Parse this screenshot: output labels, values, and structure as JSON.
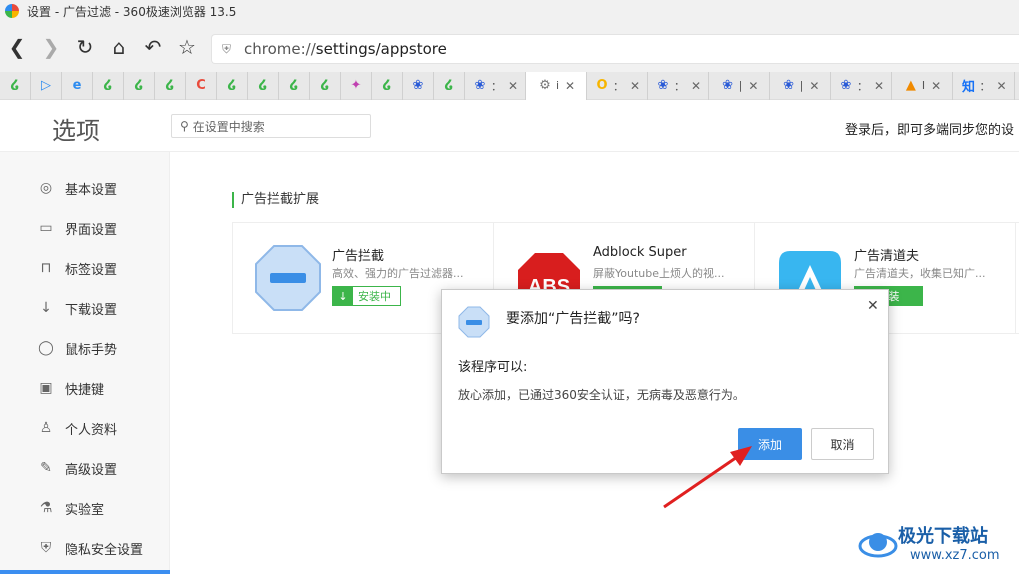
{
  "window": {
    "title": "设置 - 广告过滤 - 360极速浏览器 13.5"
  },
  "address": {
    "url_prefix": "chrome://",
    "url_rest": "settings/appstore"
  },
  "tabs": [
    {
      "icon": "360-icon",
      "color": "#3cb54a",
      "glyph": "໒",
      "close": false
    },
    {
      "icon": "play-icon",
      "color": "#2d8cf0",
      "glyph": "▷",
      "close": false
    },
    {
      "icon": "ie-icon",
      "color": "#2d8cf0",
      "glyph": "e",
      "close": false
    },
    {
      "icon": "360-icon",
      "color": "#3cb54a",
      "glyph": "໒",
      "close": false
    },
    {
      "icon": "360-icon",
      "color": "#3cb54a",
      "glyph": "໒",
      "close": false
    },
    {
      "icon": "360-icon",
      "color": "#3cb54a",
      "glyph": "໒",
      "close": false
    },
    {
      "icon": "c-icon",
      "color": "#e94b3c",
      "glyph": "C",
      "close": false
    },
    {
      "icon": "360-icon",
      "color": "#3cb54a",
      "glyph": "໒",
      "close": false
    },
    {
      "icon": "360-icon",
      "color": "#3cb54a",
      "glyph": "໒",
      "close": false
    },
    {
      "icon": "360-icon",
      "color": "#3cb54a",
      "glyph": "໒",
      "close": false
    },
    {
      "icon": "360-icon",
      "color": "#3cb54a",
      "glyph": "໒",
      "close": false
    },
    {
      "icon": "star-color-icon",
      "color": "#c03fb0",
      "glyph": "✦",
      "close": false
    },
    {
      "icon": "360-icon",
      "color": "#3cb54a",
      "glyph": "໒",
      "close": false
    },
    {
      "icon": "baidu-icon",
      "color": "#2a5bd7",
      "glyph": "❀",
      "close": false
    },
    {
      "icon": "360-icon",
      "color": "#3cb54a",
      "glyph": "໒",
      "close": false
    },
    {
      "icon": "baidu-icon",
      "color": "#2a5bd7",
      "glyph": "❀",
      "close": true,
      "label": "："
    },
    {
      "icon": "gear-icon",
      "color": "#777",
      "glyph": "⚙",
      "close": true,
      "label": "i",
      "active": true
    },
    {
      "icon": "search-o-icon",
      "color": "#f7b500",
      "glyph": "O",
      "close": true,
      "label": "："
    },
    {
      "icon": "baidu-icon",
      "color": "#2a5bd7",
      "glyph": "❀",
      "close": true,
      "label": "："
    },
    {
      "icon": "baidu-icon",
      "color": "#2a5bd7",
      "glyph": "❀",
      "close": true,
      "label": "|"
    },
    {
      "icon": "baidu-icon",
      "color": "#2a5bd7",
      "glyph": "❀",
      "close": true,
      "label": "|"
    },
    {
      "icon": "baidu-icon",
      "color": "#2a5bd7",
      "glyph": "❀",
      "close": true,
      "label": "："
    },
    {
      "icon": "vlc-icon",
      "color": "#f08a00",
      "glyph": "▲",
      "close": true,
      "label": "I"
    },
    {
      "icon": "zhihu-icon",
      "color": "#1772f6",
      "glyph": "知",
      "close": true,
      "label": "："
    }
  ],
  "options": {
    "title": "选项",
    "search_placeholder": "在设置中搜索",
    "login_text": "登录后，即可多端同步您的设"
  },
  "sidebar": {
    "items": [
      {
        "label": "基本设置",
        "icon": "settings-circle-icon",
        "glyph": "◎"
      },
      {
        "label": "界面设置",
        "icon": "window-icon",
        "glyph": "▭"
      },
      {
        "label": "标签设置",
        "icon": "tab-icon",
        "glyph": "⊓"
      },
      {
        "label": "下载设置",
        "icon": "download-icon",
        "glyph": "↓"
      },
      {
        "label": "鼠标手势",
        "icon": "mouse-icon",
        "glyph": "◯"
      },
      {
        "label": "快捷键",
        "icon": "shortcut-icon",
        "glyph": "▣"
      },
      {
        "label": "个人资料",
        "icon": "user-icon",
        "glyph": "♙"
      },
      {
        "label": "高级设置",
        "icon": "wrench-icon",
        "glyph": "✎"
      },
      {
        "label": "实验室",
        "icon": "flask-icon",
        "glyph": "⚗"
      },
      {
        "label": "隐私安全设置",
        "icon": "shield-icon",
        "glyph": "⛨"
      }
    ]
  },
  "main": {
    "section_title": "广告拦截扩展",
    "extensions": [
      {
        "name": "广告拦截",
        "desc": "高效、强力的广告过滤器...",
        "button": "安装中",
        "state": "installing"
      },
      {
        "name": "Adblock Super",
        "desc": "屏蔽Youtube上烦人的视...",
        "button": "安装",
        "state": "install"
      },
      {
        "name": "广告清道夫",
        "desc": "广告清道夫，收集已知广...",
        "button": "安装",
        "state": "install"
      }
    ]
  },
  "dialog": {
    "title": "要添加“广告拦截”吗?",
    "subtitle": "该程序可以:",
    "body": "放心添加，已通过360安全认证，无病毒及恶意行为。",
    "add_label": "添加",
    "cancel_label": "取消",
    "close_glyph": "✕"
  },
  "watermark": {
    "text": "极光下载站",
    "url": "www.xz7.com"
  },
  "colors": {
    "accent_blue": "#3a8ee6",
    "green": "#3cb54a",
    "arrow_red": "#e02020"
  }
}
